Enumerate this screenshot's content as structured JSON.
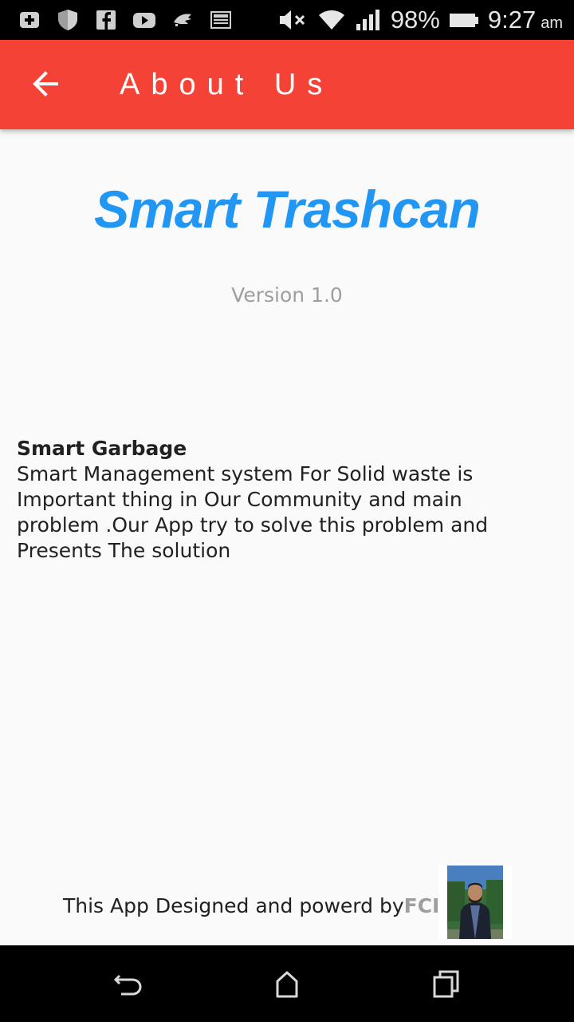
{
  "status_bar": {
    "battery": "98%",
    "time": "9:27",
    "ampm": "am",
    "icons": [
      "add-box-icon",
      "shield-icon",
      "facebook-icon",
      "youtube-icon",
      "app-icon",
      "screen-icon",
      "volume-mute-icon",
      "wifi-icon",
      "signal-icon",
      "battery-icon"
    ]
  },
  "app_bar": {
    "title": "About Us",
    "back_icon": "arrow-back-icon",
    "color": "#f44336"
  },
  "content": {
    "app_name": "Smart Trashcan",
    "version": "Version 1.0",
    "heading": "Smart Garbage",
    "description": "Smart Management system For Solid waste is Important thing in Our Community and main problem .Our App try to solve this problem and Presents The solution"
  },
  "footer": {
    "text": "This App Designed and powerd by",
    "brand": "FCI"
  },
  "nav_bar": {
    "icons": [
      "back-icon",
      "home-icon",
      "recents-icon"
    ]
  },
  "colors": {
    "accent": "#2196f3",
    "muted": "#9e9e9e",
    "background": "#fafafa"
  }
}
